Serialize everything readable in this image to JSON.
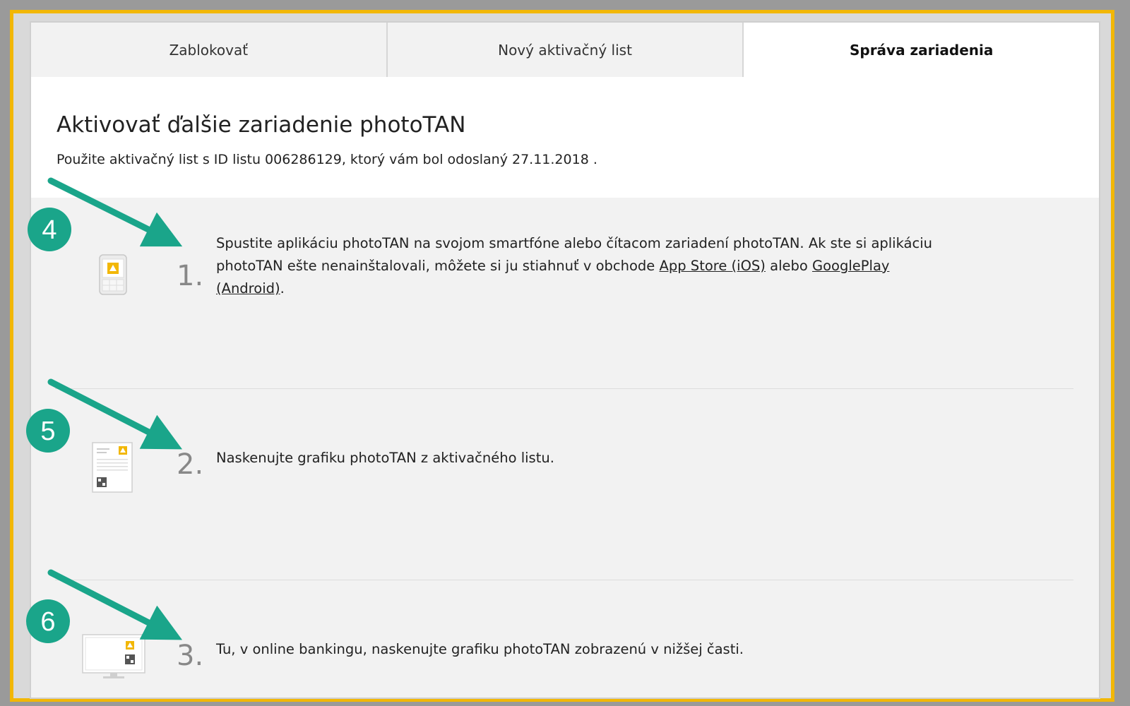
{
  "tabs": [
    {
      "label": "Zablokovať",
      "active": false
    },
    {
      "label": "Nový aktivačný list",
      "active": false
    },
    {
      "label": "Správa zariadenia",
      "active": true
    }
  ],
  "header": {
    "title": "Aktivovať ďalšie zariadenie photoTAN",
    "subtitle": "Použite aktivačný list s ID listu 006286129, ktorý vám bol odoslaný 27.11.2018 ."
  },
  "steps": [
    {
      "number": "1.",
      "text_before": "Spustite aplikáciu photoTAN na svojom smartfóne alebo čítacom zariadení photoTAN. Ak ste si aplikáciu photoTAN ešte nenainštalovali, môžete si ju stiahnuť v obchode ",
      "link1": "App Store (iOS)",
      "text_between": " alebo ",
      "link2": "GooglePlay (Android)",
      "text_after": ".",
      "icon": "smartphone-icon"
    },
    {
      "number": "2.",
      "text": "Naskenujte grafiku photoTAN z aktivačného listu.",
      "icon": "activation-letter-icon"
    },
    {
      "number": "3.",
      "text": "Tu, v online bankingu, naskenujte grafiku photoTAN zobrazenú v nižšej časti.",
      "icon": "monitor-icon"
    }
  ],
  "annotations": [
    {
      "label": "4"
    },
    {
      "label": "5"
    },
    {
      "label": "6"
    }
  ],
  "colors": {
    "frame": "#f2b705",
    "annotation": "#1aa58a",
    "brand_yellow": "#f2b705"
  }
}
